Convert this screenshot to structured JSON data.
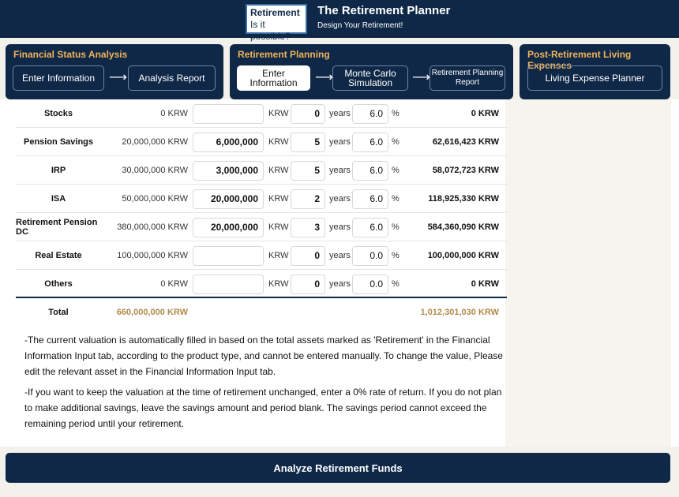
{
  "header": {
    "logo_line1": "Retirement",
    "logo_line2": "Is it possible?",
    "title": "The Retirement Planner",
    "subtitle": "Design Your Retirement!"
  },
  "nav": {
    "financial_status": {
      "title": "Financial Status Analysis",
      "steps": [
        "Enter Information",
        "Analysis Report"
      ]
    },
    "retirement_planning": {
      "title": "Retirement Planning",
      "steps": [
        "Enter Information",
        "Monte Carlo\nSimulation",
        "Retirement Planning\nReport"
      ],
      "active_step": "Enter Information"
    },
    "post_retirement": {
      "title": "Post-Retirement Living Expenses",
      "steps": [
        "Living Expense Planner"
      ]
    },
    "arrow": "⟶"
  },
  "table": {
    "rows": [
      {
        "name": "Stocks",
        "current": "0 KRW",
        "amount": "",
        "unit": "KRW",
        "years": "0",
        "years_label": "years",
        "rate": "6.0",
        "pct": "%",
        "future": "0 KRW"
      },
      {
        "name": "Pension Savings",
        "current": "20,000,000 KRW",
        "amount": "6,000,000",
        "unit": "KRW",
        "years": "5",
        "years_label": "years",
        "rate": "6.0",
        "pct": "%",
        "future": "62,616,423 KRW"
      },
      {
        "name": "IRP",
        "current": "30,000,000 KRW",
        "amount": "3,000,000",
        "unit": "KRW",
        "years": "5",
        "years_label": "years",
        "rate": "6.0",
        "pct": "%",
        "future": "58,072,723 KRW"
      },
      {
        "name": "ISA",
        "current": "50,000,000 KRW",
        "amount": "20,000,000",
        "unit": "KRW",
        "years": "2",
        "years_label": "years",
        "rate": "6.0",
        "pct": "%",
        "future": "118,925,330 KRW"
      },
      {
        "name": "Retirement Pension DC",
        "current": "380,000,000 KRW",
        "amount": "20,000,000",
        "unit": "KRW",
        "years": "3",
        "years_label": "years",
        "rate": "6.0",
        "pct": "%",
        "future": "584,360,090 KRW"
      },
      {
        "name": "Real Estate",
        "current": "100,000,000 KRW",
        "amount": "",
        "unit": "KRW",
        "years": "0",
        "years_label": "years",
        "rate": "0.0",
        "pct": "%",
        "future": "100,000,000 KRW"
      },
      {
        "name": "Others",
        "current": "0 KRW",
        "amount": "",
        "unit": "KRW",
        "years": "0",
        "years_label": "years",
        "rate": "0.0",
        "pct": "%",
        "future": "0 KRW"
      }
    ],
    "total": {
      "label": "Total",
      "current": "660,000,000 KRW",
      "future": "1,012,301,030 KRW"
    }
  },
  "notes": {
    "note1": "-The current valuation is automatically filled in based on the total assets marked as 'Retirement' in the Financial Information Input tab, according to the product type, and cannot be entered manually. To change the value, Please edit the relevant asset in the Financial Information Input tab.",
    "note2": "-If you want to keep the valuation at the time of retirement unchanged, enter a 0% rate of return. If you do not plan to make additional savings, leave the savings amount and period blank. The savings period cannot exceed the remaining period until your retirement."
  },
  "analyze_button": "Analyze Retirement Funds"
}
